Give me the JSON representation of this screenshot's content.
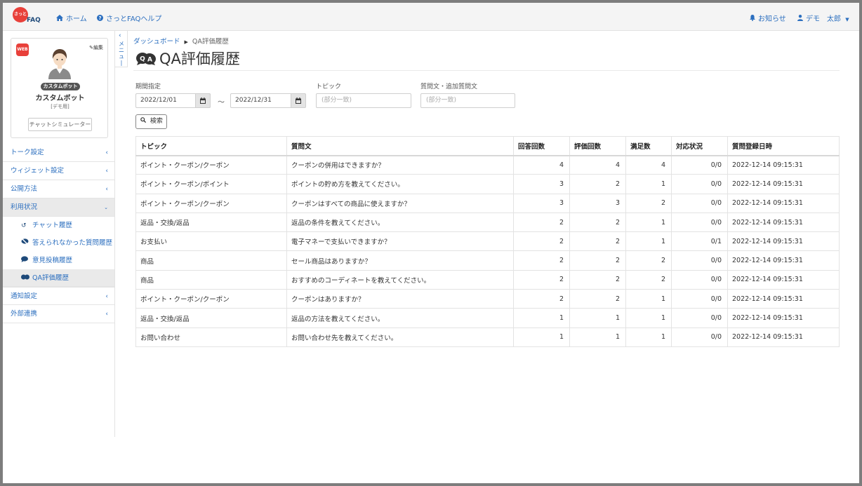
{
  "header": {
    "logo_text": "FAQ",
    "logo_mark": "さっと",
    "nav": [
      {
        "label": "ホーム",
        "icon": "home-icon"
      },
      {
        "label": "さっとFAQヘルプ",
        "icon": "help-circle-icon"
      }
    ],
    "notifications_label": "お知らせ",
    "user_label": "デモ　太郎"
  },
  "sidebar": {
    "web_badge": "WEB",
    "edit_label": "編集",
    "bot_pill": "カスタムボット",
    "bot_name": "カスタムボット",
    "bot_sub": "[デモ用]",
    "simulator_label": "チャットシミュレーター",
    "menu_toggle_label": "メニュー",
    "items": [
      {
        "label": "トーク設定"
      },
      {
        "label": "ウィジェット設定"
      },
      {
        "label": "公開方法"
      },
      {
        "label": "利用状況"
      },
      {
        "label": "通知設定"
      },
      {
        "label": "外部連携"
      }
    ],
    "sub_items": [
      {
        "label": "チャット履歴",
        "icon": "history-icon"
      },
      {
        "label": "答えられなかった質問履歴",
        "icon": "no-comment-icon"
      },
      {
        "label": "意見投稿履歴",
        "icon": "comment-icon"
      },
      {
        "label": "QA評価履歴",
        "icon": "qa-icon"
      }
    ]
  },
  "breadcrumb": {
    "root": "ダッシュボード",
    "current": "QA評価履歴"
  },
  "page_title": "QA評価履歴",
  "filters": {
    "period_label": "期間指定",
    "date_from": "2022/12/01",
    "date_to": "2022/12/31",
    "tilde": "～",
    "topic_label": "トピック",
    "topic_placeholder": "(部分一致)",
    "question_label": "質問文・追加質問文",
    "question_placeholder": "(部分一致)",
    "search_label": "検索"
  },
  "table": {
    "headers": [
      "トピック",
      "質問文",
      "回答回数",
      "評価回数",
      "満足数",
      "対応状況",
      "質問登録日時"
    ],
    "rows": [
      [
        "ポイント・クーポン/クーポン",
        "クーポンの併用はできますか？",
        "4",
        "4",
        "4",
        "0/0",
        "2022-12-14 09:15:31"
      ],
      [
        "ポイント・クーポン/ポイント",
        "ポイントの貯め方を教えてください。",
        "3",
        "2",
        "1",
        "0/0",
        "2022-12-14 09:15:31"
      ],
      [
        "ポイント・クーポン/クーポン",
        "クーポンはすべての商品に使えますか？",
        "3",
        "3",
        "2",
        "0/0",
        "2022-12-14 09:15:31"
      ],
      [
        "返品・交換/返品",
        "返品の条件を教えてください。",
        "2",
        "2",
        "1",
        "0/0",
        "2022-12-14 09:15:31"
      ],
      [
        "お支払い",
        "電子マネーで支払いできますか？",
        "2",
        "2",
        "1",
        "0/1",
        "2022-12-14 09:15:31"
      ],
      [
        "商品",
        "セール商品はありますか？",
        "2",
        "2",
        "2",
        "0/0",
        "2022-12-14 09:15:31"
      ],
      [
        "商品",
        "おすすめのコーディネートを教えてください。",
        "2",
        "2",
        "2",
        "0/0",
        "2022-12-14 09:15:31"
      ],
      [
        "ポイント・クーポン/クーポン",
        "クーポンはありますか？",
        "2",
        "2",
        "1",
        "0/0",
        "2022-12-14 09:15:31"
      ],
      [
        "返品・交換/返品",
        "返品の方法を教えてください。",
        "1",
        "1",
        "1",
        "0/0",
        "2022-12-14 09:15:31"
      ],
      [
        "お問い合わせ",
        "お問い合わせ先を教えてください。",
        "1",
        "1",
        "1",
        "0/0",
        "2022-12-14 09:15:31"
      ]
    ]
  }
}
